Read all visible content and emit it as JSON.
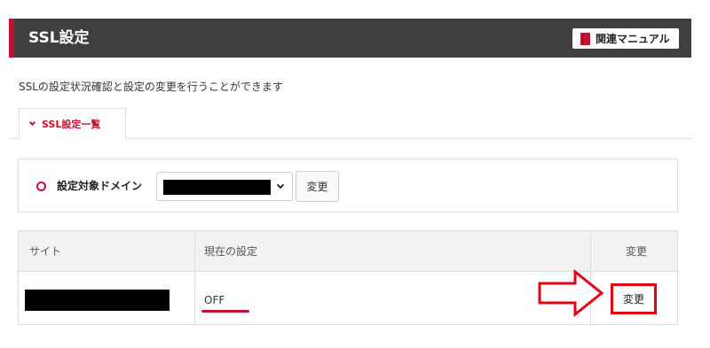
{
  "header": {
    "title": "SSL設定",
    "manual_label": "関連マニュアル",
    "manual_icon": "book-icon"
  },
  "description": "SSLの設定状況確認と設定の変更を行うことができます",
  "tab": {
    "label": "SSL設定一覧",
    "icon": "chevron-down-icon"
  },
  "domain_selector": {
    "label": "設定対象ドメイン",
    "selected_value": "",
    "change_label": "変更"
  },
  "table": {
    "columns": [
      "サイト",
      "現在の設定",
      "変更"
    ],
    "rows": [
      {
        "site": "",
        "current_setting": "OFF",
        "change_label": "変更"
      }
    ]
  },
  "colors": {
    "accent": "#c8102e",
    "header_bg": "#3f3f3f",
    "highlight": "#e60012"
  }
}
